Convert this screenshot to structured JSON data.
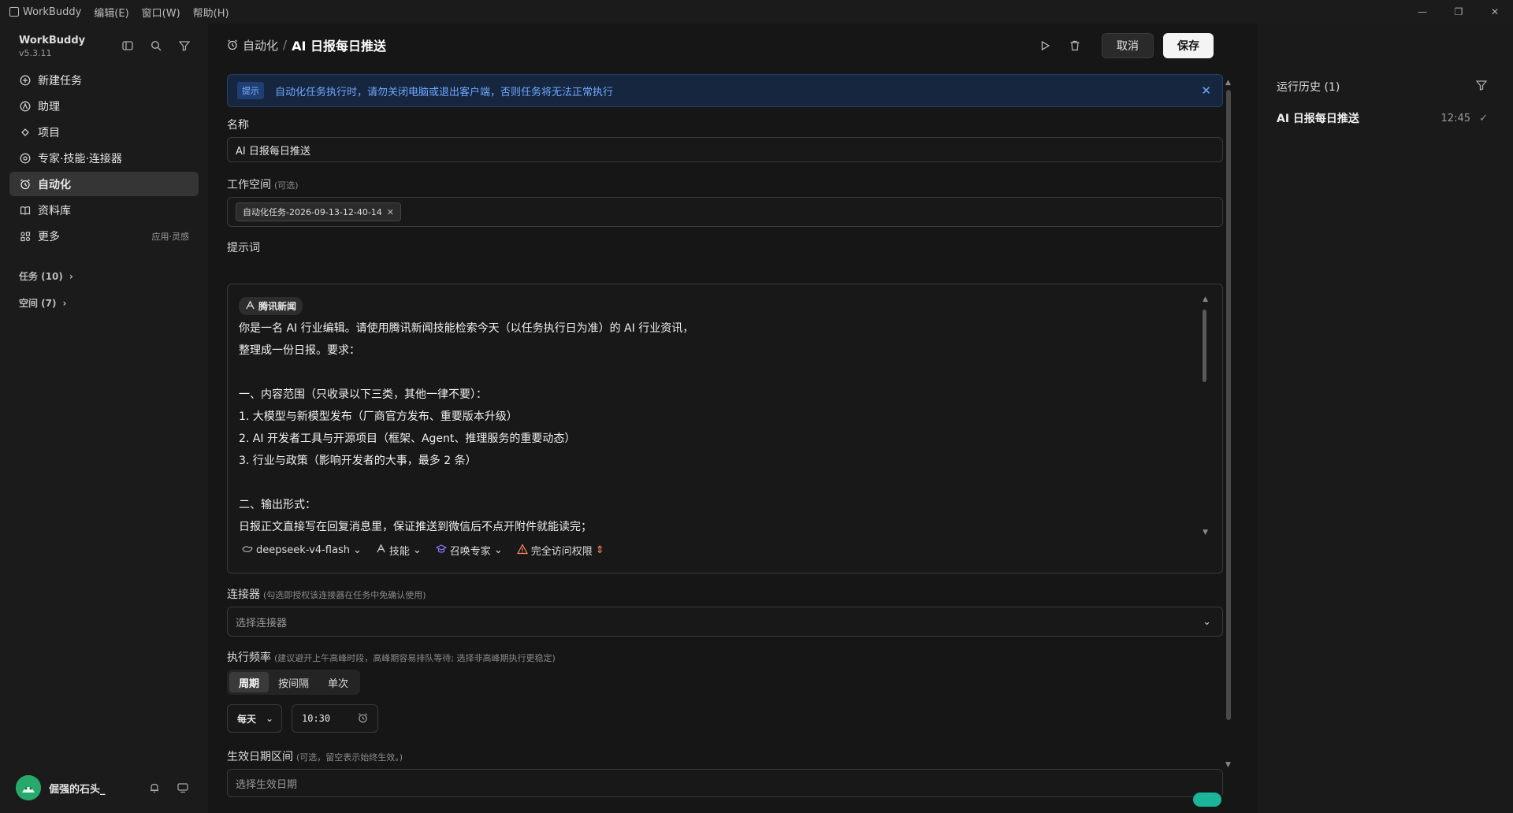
{
  "titlebar": {
    "app_name": "WorkBuddy",
    "menus": [
      "编辑(E)",
      "窗口(W)",
      "帮助(H)"
    ]
  },
  "sidebar": {
    "brand": "WorkBuddy",
    "version": "v5.3.11",
    "items": [
      {
        "label": "新建任务",
        "icon": "plus-circle-icon"
      },
      {
        "label": "助理",
        "icon": "assistant-icon"
      },
      {
        "label": "项目",
        "icon": "project-icon"
      },
      {
        "label": "专家·技能·连接器",
        "icon": "expert-icon"
      },
      {
        "label": "自动化",
        "icon": "alarm-clock-icon",
        "active": true
      },
      {
        "label": "资料库",
        "icon": "book-icon"
      },
      {
        "label": "更多",
        "icon": "apps-icon",
        "extra": "应用·灵感"
      }
    ],
    "groups": [
      {
        "label": "任务 (10)"
      },
      {
        "label": "空间 (7)"
      }
    ],
    "user": {
      "name": "倔强的石头_",
      "avatar_color": "#27a96b"
    }
  },
  "header": {
    "breadcrumb_parent": "自动化",
    "breadcrumb_sep": "/",
    "title": "AI 日报每日推送",
    "cancel_label": "取消",
    "save_label": "保存"
  },
  "notice": {
    "tag": "提示",
    "text": "自动化任务执行时，请勿关闭电脑或退出客户端，否则任务将无法正常执行"
  },
  "form": {
    "name_label": "名称",
    "name_value": "AI 日报每日推送",
    "workspace_label": "工作空间",
    "workspace_hint": "(可选)",
    "workspace_chip": "自动化任务-2026-09-13-12-40-14",
    "prompt_label": "提示词",
    "prompt_skill_tag": "腾讯新闻",
    "prompt_lines": [
      "你是一名 AI 行业编辑。请使用腾讯新闻技能检索今天（以任务执行日为准）的 AI 行业资讯，",
      "整理成一份日报。要求：",
      "",
      "一、内容范围（只收录以下三类，其他一律不要）：",
      "1. 大模型与新模型发布（厂商官方发布、重要版本升级）",
      "2. AI 开发者工具与开源项目（框架、Agent、推理服务的重要动态）",
      "3. 行业与政策（影响开发者的大事，最多 2 条）",
      "",
      "二、输出形式：",
      "日报正文直接写在回复消息里，保证推送到微信后不点开附件就能读完；"
    ],
    "prompt_toolbar": {
      "model": "deepseek-v4-flash",
      "skills": "技能",
      "expert": "召唤专家",
      "permission": "完全访问权限"
    },
    "connector_label": "连接器",
    "connector_hint": "(勾选即授权该连接器在任务中免确认使用)",
    "connector_placeholder": "选择连接器",
    "freq_label": "执行频率",
    "freq_hint": "(建议避开上午高峰时段，高峰期容易排队等待; 选择非高峰期执行更稳定)",
    "freq_tabs": [
      "周期",
      "按间隔",
      "单次"
    ],
    "freq_period": "每天",
    "freq_time": "10:30",
    "date_label": "生效日期区间",
    "date_hint": "(可选，留空表示始终生效。)",
    "date_placeholder": "选择生效日期"
  },
  "history": {
    "title": "运行历史 (1)",
    "items": [
      {
        "name": "AI 日报每日推送",
        "time": "12:45"
      }
    ]
  },
  "colors": {
    "accent_blue": "#6ea8ff",
    "toggle_on": "#1bb59a",
    "warning": "#ff8a5c"
  }
}
